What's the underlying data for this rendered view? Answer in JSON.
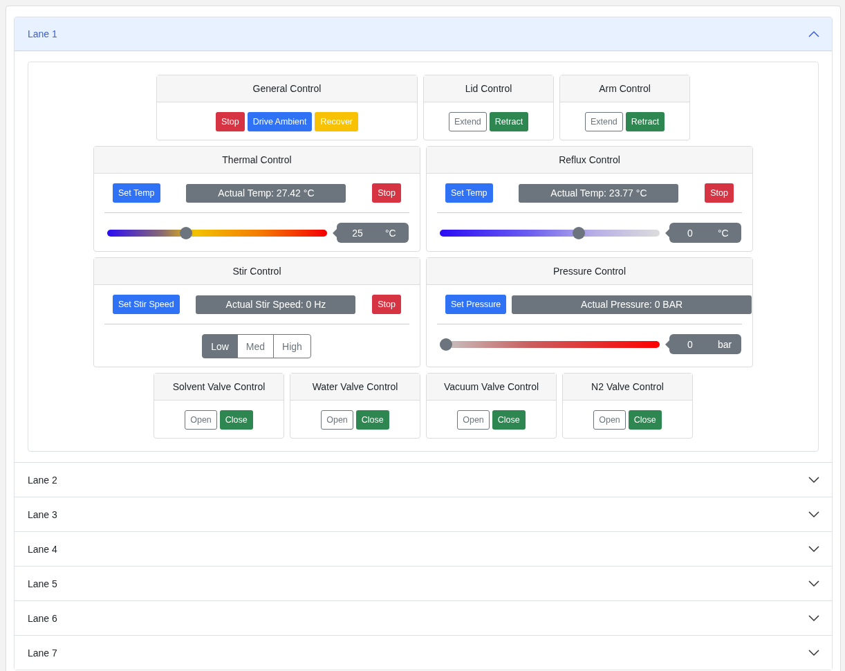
{
  "lanes": [
    {
      "label": "Lane 1",
      "expanded": true,
      "rows": [
        {
          "panels": [
            {
              "kind": "buttons",
              "title": "General Control",
              "buttons": [
                {
                  "label": "Stop",
                  "kind": "danger"
                },
                {
                  "label": "Drive Ambient",
                  "kind": "primary"
                },
                {
                  "label": "Recover",
                  "kind": "warning"
                }
              ]
            },
            {
              "kind": "buttons",
              "title": "Lid Control",
              "buttons": [
                {
                  "label": "Extend",
                  "kind": "outline"
                },
                {
                  "label": "Retract",
                  "kind": "success"
                }
              ]
            },
            {
              "kind": "buttons",
              "title": "Arm Control",
              "buttons": [
                {
                  "label": "Extend",
                  "kind": "outline"
                },
                {
                  "label": "Retract",
                  "kind": "success"
                }
              ]
            }
          ]
        },
        {
          "panels": [
            {
              "kind": "setpoint",
              "title": "Thermal Control",
              "set_button": "Set Temp",
              "reading": "Actual Temp: 27.42 °C",
              "stop_button": "Stop",
              "slider": {
                "kind": "heat",
                "level": 0.35,
                "value": "25",
                "unit": "°C"
              }
            },
            {
              "kind": "setpoint",
              "title": "Reflux Control",
              "set_button": "Set Temp",
              "reading": "Actual Temp: 23.77 °C",
              "stop_button": "Stop",
              "slider": {
                "kind": "cool",
                "level": 0.64,
                "value": "0",
                "unit": "°C"
              }
            }
          ]
        },
        {
          "panels": [
            {
              "kind": "stir",
              "title": "Stir Control",
              "set_button": "Set Stir Speed",
              "reading": "Actual Stir Speed: 0 Hz",
              "stop_button": "Stop",
              "options": [
                {
                  "label": "Low",
                  "selected": true
                },
                {
                  "label": "Med",
                  "selected": false
                },
                {
                  "label": "High",
                  "selected": false
                }
              ]
            },
            {
              "kind": "setpoint",
              "title": "Pressure Control",
              "set_button": "Set Pressure",
              "reading": "Actual Pressure: 0 BAR",
              "slider": {
                "kind": "pressure",
                "level": 0,
                "value": "0",
                "unit": "bar"
              }
            }
          ]
        },
        {
          "panels": [
            {
              "kind": "buttons",
              "title": "Solvent Valve Control",
              "buttons": [
                {
                  "label": "Open",
                  "kind": "outline"
                },
                {
                  "label": "Close",
                  "kind": "success"
                }
              ]
            },
            {
              "kind": "buttons",
              "title": "Water Valve Control",
              "buttons": [
                {
                  "label": "Open",
                  "kind": "outline"
                },
                {
                  "label": "Close",
                  "kind": "success"
                }
              ]
            },
            {
              "kind": "buttons",
              "title": "Vacuum Valve Control",
              "buttons": [
                {
                  "label": "Open",
                  "kind": "outline"
                },
                {
                  "label": "Close",
                  "kind": "success"
                }
              ]
            },
            {
              "kind": "buttons",
              "title": "N2 Valve Control",
              "buttons": [
                {
                  "label": "Open",
                  "kind": "outline"
                },
                {
                  "label": "Close",
                  "kind": "success"
                }
              ]
            }
          ]
        }
      ]
    },
    {
      "label": "Lane 2",
      "expanded": false
    },
    {
      "label": "Lane 3",
      "expanded": false
    },
    {
      "label": "Lane 4",
      "expanded": false
    },
    {
      "label": "Lane 5",
      "expanded": false
    },
    {
      "label": "Lane 6",
      "expanded": false
    },
    {
      "label": "Lane 7",
      "expanded": false
    }
  ]
}
